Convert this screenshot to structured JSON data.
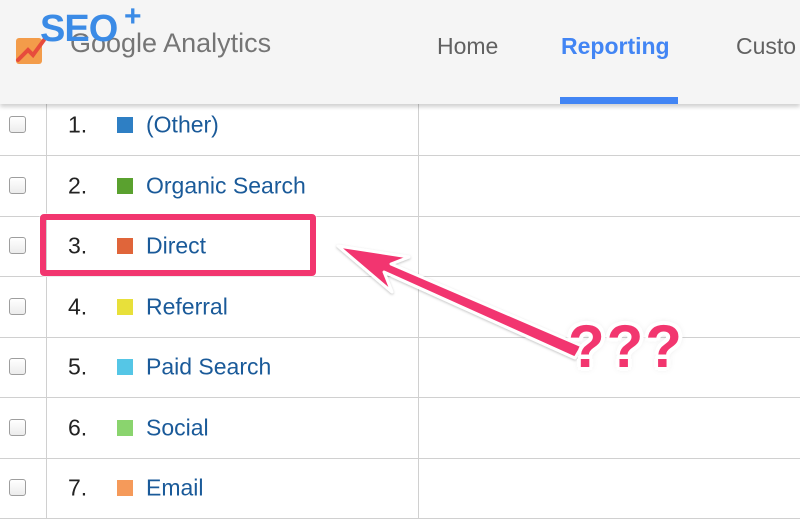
{
  "header": {
    "logo": {
      "seo_text": "SEO",
      "seo_plus": "+",
      "product": "Google Analytics"
    },
    "nav": [
      {
        "label": "Home",
        "active": false
      },
      {
        "label": "Reporting",
        "active": true
      },
      {
        "label": "Custo",
        "active": false
      }
    ]
  },
  "table": {
    "rows": [
      {
        "num": "1.",
        "label": "(Other)",
        "color": "#2e7fc4"
      },
      {
        "num": "2.",
        "label": "Organic Search",
        "color": "#5aa12f"
      },
      {
        "num": "3.",
        "label": "Direct",
        "color": "#e0653a"
      },
      {
        "num": "4.",
        "label": "Referral",
        "color": "#e8e03a"
      },
      {
        "num": "5.",
        "label": "Paid Search",
        "color": "#55c6e6"
      },
      {
        "num": "6.",
        "label": "Social",
        "color": "#8ad46e"
      },
      {
        "num": "7.",
        "label": "Email",
        "color": "#f59a5a"
      }
    ]
  },
  "annotation": {
    "question_marks": "???",
    "color": "#f2366f"
  }
}
